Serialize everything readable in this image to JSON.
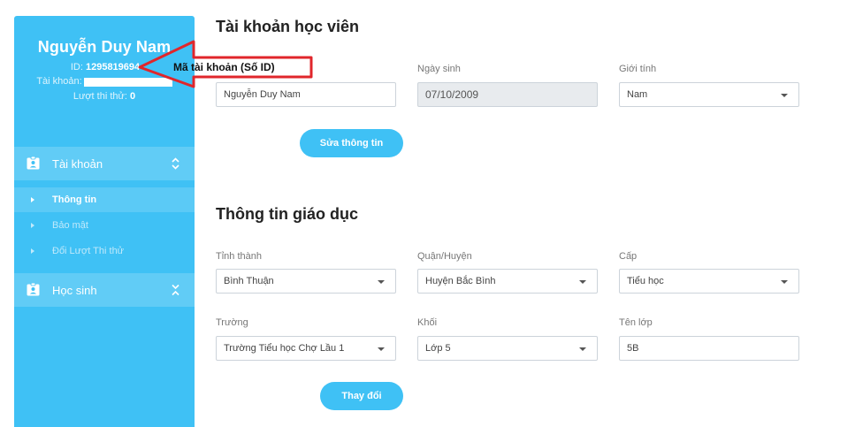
{
  "sidebar": {
    "profile": {
      "name": "Nguyễn Duy Nam",
      "id_label": "ID:",
      "id_value": "1295819694",
      "account_label": "Tài khoản:",
      "trials_label": "Lượt thi thử:",
      "trials_value": "0"
    },
    "sections": [
      {
        "label": "Tài khoản",
        "icon": "contact-card-icon",
        "chevron": "chevron-up-down-icon"
      },
      {
        "label": "Học sinh",
        "icon": "contact-card-icon",
        "chevron": "chevron-collapse-icon"
      }
    ],
    "submenu": [
      {
        "label": "Thông tin",
        "active": true
      },
      {
        "label": "Bảo mật",
        "active": false
      },
      {
        "label": "Đổi Lượt Thi thử",
        "active": false
      }
    ]
  },
  "annotation": {
    "label": "Mã tài khoản (Số ID)",
    "color": "#e0262b"
  },
  "student": {
    "title": "Tài khoản học viên",
    "name_value": "Nguyễn Duy Nam",
    "dob_label": "Ngày sinh",
    "dob_value": "07/10/2009",
    "gender_label": "Giới tính",
    "gender_value": "Nam",
    "edit_button": "Sửa thông tin"
  },
  "education": {
    "title": "Thông tin giáo dục",
    "province_label": "Tỉnh thành",
    "province_value": "Bình Thuận",
    "district_label": "Quận/Huyện",
    "district_value": "Huyện Bắc Bình",
    "level_label": "Cấp",
    "level_value": "Tiểu học",
    "school_label": "Trường",
    "school_value": "Trường Tiểu học Chợ Lầu 1",
    "grade_label": "Khối",
    "grade_value": "Lớp 5",
    "class_label": "Tên lớp",
    "class_value": "5B",
    "change_button": "Thay đổi"
  },
  "colors": {
    "accent": "#3fc1f5"
  }
}
